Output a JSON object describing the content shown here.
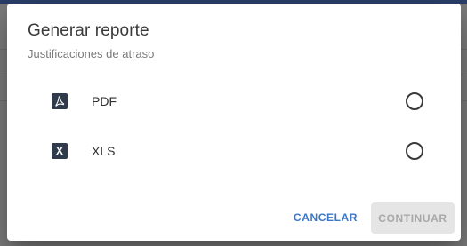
{
  "dialog": {
    "title": "Generar reporte",
    "subtitle": "Justificaciones de atraso",
    "options": [
      {
        "label": "PDF",
        "icon": "pdf-file-icon",
        "selected": false
      },
      {
        "label": "XLS",
        "icon": "excel-file-icon",
        "icon_glyph": "X",
        "selected": false
      }
    ],
    "actions": {
      "cancel_label": "CANCELAR",
      "continue_label": "CONTINUAR",
      "continue_disabled": true
    }
  },
  "colors": {
    "accent": "#3a78c9",
    "topbar": "#2a3f6a",
    "icon_bg": "#2f3a4a",
    "disabled_bg": "#e5e5e5",
    "disabled_text": "#a8a8a8"
  }
}
